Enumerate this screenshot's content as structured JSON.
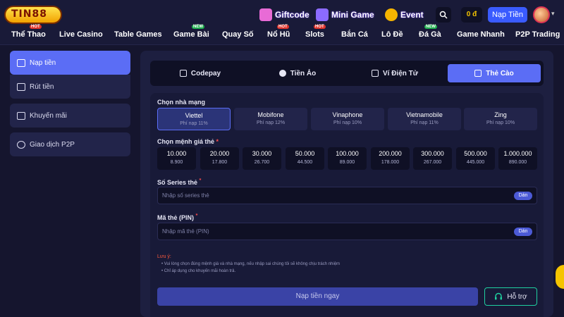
{
  "header": {
    "logo": "TIN88",
    "promos": [
      {
        "label": "Giftcode",
        "icon": "gift-icon",
        "color": "#e86bd6"
      },
      {
        "label": "Mini Game",
        "icon": "controller-icon",
        "color": "#8c6bff"
      },
      {
        "label": "Event",
        "icon": "megaphone-icon",
        "color": "#f5b400"
      }
    ],
    "balance": "0 đ",
    "deposit_button": "Nạp Tiền"
  },
  "nav": {
    "items": [
      {
        "label": "Thể Thao",
        "tag": "HOT"
      },
      {
        "label": "Live Casino",
        "tag": ""
      },
      {
        "label": "Table Games",
        "tag": ""
      },
      {
        "label": "Game Bài",
        "tag": "NEW"
      },
      {
        "label": "Quay Số",
        "tag": ""
      },
      {
        "label": "Nổ Hũ",
        "tag": "HOT"
      },
      {
        "label": "Slots",
        "tag": "HOT"
      },
      {
        "label": "Bắn Cá",
        "tag": ""
      },
      {
        "label": "Lô Đề",
        "tag": ""
      },
      {
        "label": "Đá Gà",
        "tag": "NEW"
      },
      {
        "label": "Game Nhanh",
        "tag": ""
      },
      {
        "label": "P2P Trading",
        "tag": ""
      }
    ]
  },
  "sidebar": {
    "items": [
      {
        "label": "Nạp tiền",
        "icon": "wallet-icon",
        "active": true
      },
      {
        "label": "Rút tiền",
        "icon": "safe-icon",
        "active": false
      },
      {
        "label": "Khuyến mãi",
        "icon": "gift-icon",
        "active": false
      },
      {
        "label": "Giao dịch P2P",
        "icon": "users-icon",
        "active": false
      }
    ]
  },
  "tabs": [
    {
      "label": "Codepay",
      "icon": "scan-icon"
    },
    {
      "label": "Tiền Ảo",
      "icon": "bitcoin-icon"
    },
    {
      "label": "Ví Điện Tử",
      "icon": "ewallet-icon"
    },
    {
      "label": "Thẻ Cào",
      "icon": "card-icon",
      "active": true
    }
  ],
  "form": {
    "carrier_label": "Chọn nhà mạng",
    "carriers": [
      {
        "name": "Viettel",
        "fee": "Phí nạp 11%",
        "selected": true
      },
      {
        "name": "Mobifone",
        "fee": "Phí nạp 12%"
      },
      {
        "name": "Vinaphone",
        "fee": "Phí nạp 10%"
      },
      {
        "name": "Vietnamobile",
        "fee": "Phí nạp 11%"
      },
      {
        "name": "Zing",
        "fee": "Phí nạp 10%"
      }
    ],
    "amount_label": "Chọn mệnh giá thẻ",
    "amounts": [
      {
        "value": "10.000",
        "paid": "8.900"
      },
      {
        "value": "20.000",
        "paid": "17.800"
      },
      {
        "value": "30.000",
        "paid": "26.700"
      },
      {
        "value": "50.000",
        "paid": "44.500"
      },
      {
        "value": "100.000",
        "paid": "89.000"
      },
      {
        "value": "200.000",
        "paid": "178.000"
      },
      {
        "value": "300.000",
        "paid": "267.000"
      },
      {
        "value": "500.000",
        "paid": "445.000"
      },
      {
        "value": "1.000.000",
        "paid": "890.000"
      }
    ],
    "serial_label": "Số Series thẻ",
    "serial_placeholder": "Nhập số series thẻ",
    "pin_label": "Mã thẻ (PIN)",
    "pin_placeholder": "Nhập mã thẻ (PIN)",
    "paste_label": "Dán",
    "required_mark": "*",
    "note_title": "Lưu ý:",
    "notes": [
      "• Vui lòng chọn đúng mệnh giá và nhà mạng, nếu nhập sai chúng tôi sẽ không chịu trách nhiệm",
      "• Chỉ áp dụng cho khuyến mãi hoàn trả."
    ],
    "submit_label": "Nạp tiền ngay",
    "support_label": "Hỗ trợ"
  },
  "colors": {
    "accent": "#5b6df5",
    "background": "#15152e",
    "panel": "#1d1f40",
    "support_border": "#1fd1a0"
  }
}
